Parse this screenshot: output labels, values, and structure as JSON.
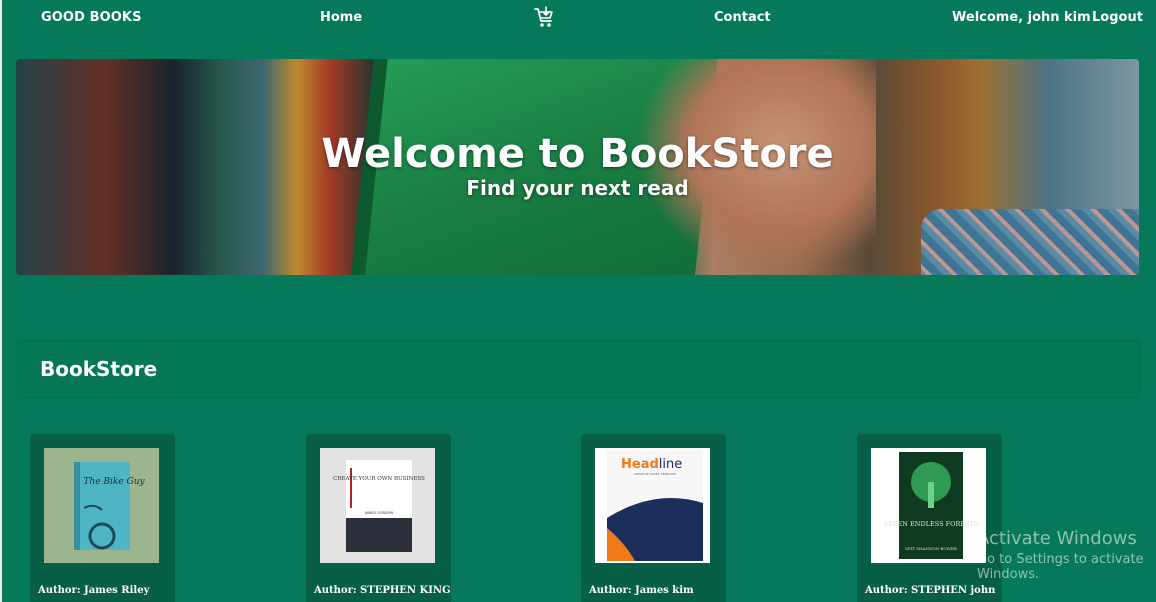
{
  "nav": {
    "brand": "GOOD BOOKS",
    "home": "Home",
    "cart_icon": "cart-icon",
    "contact": "Contact",
    "welcome": "Welcome, john kim",
    "logout": "Logout"
  },
  "hero": {
    "title": "Welcome to BookStore",
    "subtitle": "Find your next read"
  },
  "section": {
    "title": "BookStore"
  },
  "books": [
    {
      "author": "Author: James Riley",
      "cover_title": "The Bike Guy"
    },
    {
      "author": "Author: STEPHEN KING",
      "cover_title": "CREATE YOUR OWN BUSINESS",
      "cover_sub": "JAMES GORDON"
    },
    {
      "author": "Author: James kim",
      "cover_title_a": "Head",
      "cover_title_b": "line",
      "cover_sub": "CREATIVE COVER TEMPLATE"
    },
    {
      "author": "Author: STEPHEN john",
      "cover_title": "SEVEN ENDLESS FORESTS",
      "cover_sub": "SPIT SHANNON BOWER"
    }
  ],
  "watermark": {
    "line1": "Activate Windows",
    "line2": "Go to Settings to activate Windows."
  },
  "colors": {
    "background": "#05795a",
    "card": "#065f46",
    "text": "#ffffff"
  }
}
